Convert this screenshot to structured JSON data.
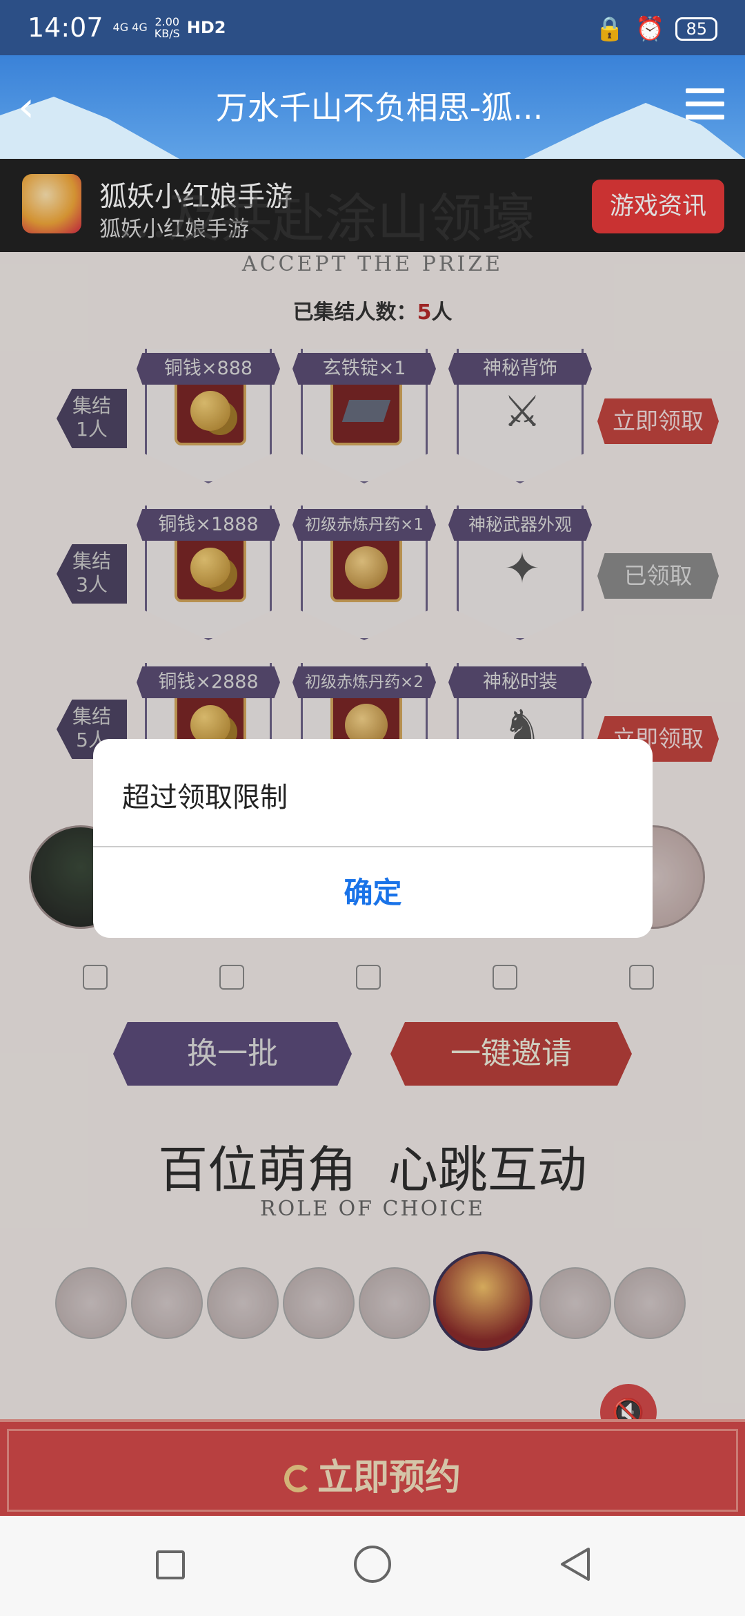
{
  "status_bar": {
    "time": "14:07",
    "network": "4G 4G",
    "speed": "2.00\nKB/S",
    "hd": "HD2",
    "battery": "85"
  },
  "nav": {
    "back_icon": "chevron-left-icon",
    "title": "万水千山不负相思-狐...",
    "menu_icon": "menu-icon"
  },
  "app_bar": {
    "app_name": "狐妖小红娘手游",
    "app_subtitle": "狐妖小红娘手游",
    "news_button": "游戏资讯"
  },
  "event": {
    "title": "...及共赴涂山领壕",
    "subtitle": "ACCEPT THE PRIZE",
    "count_label": "已集结人数：",
    "count_value": "5",
    "count_unit": "人",
    "tiers": [
      {
        "tag": "集结\n1人",
        "rewards": [
          "铜钱×888",
          "玄铁锭×1",
          "神秘背饰"
        ],
        "action": "立即领取",
        "state": "available"
      },
      {
        "tag": "集结\n3人",
        "rewards": [
          "铜钱×1888",
          "初级赤炼丹药×1",
          "神秘武器外观"
        ],
        "action": "已领取",
        "state": "claimed"
      },
      {
        "tag": "集结\n5人",
        "rewards": [
          "铜钱×2888",
          "初级赤炼丹药×2",
          "神秘时装"
        ],
        "action": "立即领取",
        "state": "available"
      }
    ],
    "swap_button": "换一批",
    "invite_button": "一键邀请"
  },
  "roles": {
    "title": "百位萌角  心跳互动",
    "subtitle": "ROLE OF CHOICE"
  },
  "reserve_button": "立即预约",
  "dialog": {
    "message": "超过领取限制",
    "confirm": "确定"
  },
  "colors": {
    "nav_blue": "#3a82d8",
    "accent_red": "#e73a3a",
    "purple": "#5b4e74",
    "link_blue": "#1a73e8"
  }
}
